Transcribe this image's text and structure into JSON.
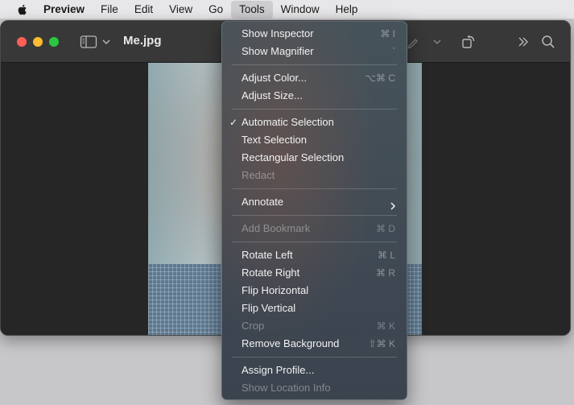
{
  "menubar": {
    "app_name": "Preview",
    "items": [
      "File",
      "Edit",
      "View",
      "Go",
      "Tools",
      "Window",
      "Help"
    ],
    "active_item": "Tools"
  },
  "window": {
    "title": "Me.jpg",
    "icons": [
      "sidebar-icon",
      "chevron-down-icon",
      "markup-icon",
      "rotate-icon",
      "more-icon",
      "search-icon"
    ]
  },
  "tools_menu": {
    "items": [
      {
        "label": "Show Inspector",
        "shortcut": "⌘ I",
        "enabled": true
      },
      {
        "label": "Show Magnifier",
        "shortcut": "`",
        "enabled": true
      },
      {
        "label": "Adjust Color...",
        "shortcut": "⌥⌘ C",
        "enabled": true
      },
      {
        "label": "Adjust Size...",
        "shortcut": "",
        "enabled": true
      },
      {
        "label": "Automatic Selection",
        "shortcut": "",
        "enabled": true,
        "checked": true
      },
      {
        "label": "Text Selection",
        "shortcut": "",
        "enabled": true
      },
      {
        "label": "Rectangular Selection",
        "shortcut": "",
        "enabled": true
      },
      {
        "label": "Redact",
        "shortcut": "",
        "enabled": false
      },
      {
        "label": "Annotate",
        "shortcut": "",
        "enabled": true,
        "submenu": true
      },
      {
        "label": "Add Bookmark",
        "shortcut": "⌘ D",
        "enabled": false
      },
      {
        "label": "Rotate Left",
        "shortcut": "⌘ L",
        "enabled": true
      },
      {
        "label": "Rotate Right",
        "shortcut": "⌘ R",
        "enabled": true
      },
      {
        "label": "Flip Horizontal",
        "shortcut": "",
        "enabled": true
      },
      {
        "label": "Flip Vertical",
        "shortcut": "",
        "enabled": true
      },
      {
        "label": "Crop",
        "shortcut": "⌘ K",
        "enabled": false
      },
      {
        "label": "Remove Background",
        "shortcut": "⇧⌘ K",
        "enabled": true
      },
      {
        "label": "Assign Profile...",
        "shortcut": "",
        "enabled": true
      },
      {
        "label": "Show Location Info",
        "shortcut": "",
        "enabled": false
      }
    ]
  },
  "colors": {
    "menubar_bg": "#e7e7e9",
    "window_bg": "#262626",
    "titlebar_bg": "#383838",
    "close": "#fe5f57",
    "minimize": "#febc2e",
    "maximize": "#28c840"
  }
}
